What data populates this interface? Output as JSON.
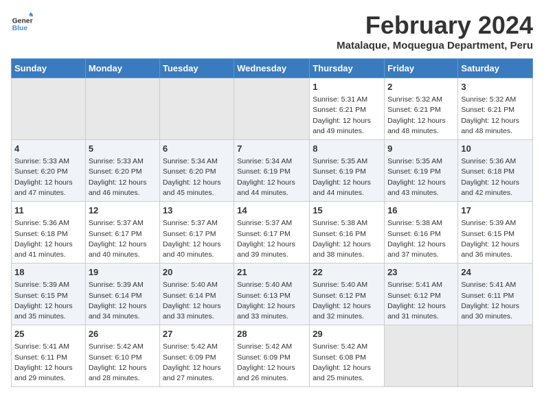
{
  "header": {
    "logo_line1": "General",
    "logo_line2": "Blue",
    "month": "February 2024",
    "location": "Matalaque, Moquegua Department, Peru"
  },
  "weekdays": [
    "Sunday",
    "Monday",
    "Tuesday",
    "Wednesday",
    "Thursday",
    "Friday",
    "Saturday"
  ],
  "weeks": [
    [
      {
        "day": "",
        "text": ""
      },
      {
        "day": "",
        "text": ""
      },
      {
        "day": "",
        "text": ""
      },
      {
        "day": "",
        "text": ""
      },
      {
        "day": "1",
        "text": "Sunrise: 5:31 AM\nSunset: 6:21 PM\nDaylight: 12 hours and 49 minutes."
      },
      {
        "day": "2",
        "text": "Sunrise: 5:32 AM\nSunset: 6:21 PM\nDaylight: 12 hours and 48 minutes."
      },
      {
        "day": "3",
        "text": "Sunrise: 5:32 AM\nSunset: 6:21 PM\nDaylight: 12 hours and 48 minutes."
      }
    ],
    [
      {
        "day": "4",
        "text": "Sunrise: 5:33 AM\nSunset: 6:20 PM\nDaylight: 12 hours and 47 minutes."
      },
      {
        "day": "5",
        "text": "Sunrise: 5:33 AM\nSunset: 6:20 PM\nDaylight: 12 hours and 46 minutes."
      },
      {
        "day": "6",
        "text": "Sunrise: 5:34 AM\nSunset: 6:20 PM\nDaylight: 12 hours and 45 minutes."
      },
      {
        "day": "7",
        "text": "Sunrise: 5:34 AM\nSunset: 6:19 PM\nDaylight: 12 hours and 44 minutes."
      },
      {
        "day": "8",
        "text": "Sunrise: 5:35 AM\nSunset: 6:19 PM\nDaylight: 12 hours and 44 minutes."
      },
      {
        "day": "9",
        "text": "Sunrise: 5:35 AM\nSunset: 6:19 PM\nDaylight: 12 hours and 43 minutes."
      },
      {
        "day": "10",
        "text": "Sunrise: 5:36 AM\nSunset: 6:18 PM\nDaylight: 12 hours and 42 minutes."
      }
    ],
    [
      {
        "day": "11",
        "text": "Sunrise: 5:36 AM\nSunset: 6:18 PM\nDaylight: 12 hours and 41 minutes."
      },
      {
        "day": "12",
        "text": "Sunrise: 5:37 AM\nSunset: 6:17 PM\nDaylight: 12 hours and 40 minutes."
      },
      {
        "day": "13",
        "text": "Sunrise: 5:37 AM\nSunset: 6:17 PM\nDaylight: 12 hours and 40 minutes."
      },
      {
        "day": "14",
        "text": "Sunrise: 5:37 AM\nSunset: 6:17 PM\nDaylight: 12 hours and 39 minutes."
      },
      {
        "day": "15",
        "text": "Sunrise: 5:38 AM\nSunset: 6:16 PM\nDaylight: 12 hours and 38 minutes."
      },
      {
        "day": "16",
        "text": "Sunrise: 5:38 AM\nSunset: 6:16 PM\nDaylight: 12 hours and 37 minutes."
      },
      {
        "day": "17",
        "text": "Sunrise: 5:39 AM\nSunset: 6:15 PM\nDaylight: 12 hours and 36 minutes."
      }
    ],
    [
      {
        "day": "18",
        "text": "Sunrise: 5:39 AM\nSunset: 6:15 PM\nDaylight: 12 hours and 35 minutes."
      },
      {
        "day": "19",
        "text": "Sunrise: 5:39 AM\nSunset: 6:14 PM\nDaylight: 12 hours and 34 minutes."
      },
      {
        "day": "20",
        "text": "Sunrise: 5:40 AM\nSunset: 6:14 PM\nDaylight: 12 hours and 33 minutes."
      },
      {
        "day": "21",
        "text": "Sunrise: 5:40 AM\nSunset: 6:13 PM\nDaylight: 12 hours and 33 minutes."
      },
      {
        "day": "22",
        "text": "Sunrise: 5:40 AM\nSunset: 6:12 PM\nDaylight: 12 hours and 32 minutes."
      },
      {
        "day": "23",
        "text": "Sunrise: 5:41 AM\nSunset: 6:12 PM\nDaylight: 12 hours and 31 minutes."
      },
      {
        "day": "24",
        "text": "Sunrise: 5:41 AM\nSunset: 6:11 PM\nDaylight: 12 hours and 30 minutes."
      }
    ],
    [
      {
        "day": "25",
        "text": "Sunrise: 5:41 AM\nSunset: 6:11 PM\nDaylight: 12 hours and 29 minutes."
      },
      {
        "day": "26",
        "text": "Sunrise: 5:42 AM\nSunset: 6:10 PM\nDaylight: 12 hours and 28 minutes."
      },
      {
        "day": "27",
        "text": "Sunrise: 5:42 AM\nSunset: 6:09 PM\nDaylight: 12 hours and 27 minutes."
      },
      {
        "day": "28",
        "text": "Sunrise: 5:42 AM\nSunset: 6:09 PM\nDaylight: 12 hours and 26 minutes."
      },
      {
        "day": "29",
        "text": "Sunrise: 5:42 AM\nSunset: 6:08 PM\nDaylight: 12 hours and 25 minutes."
      },
      {
        "day": "",
        "text": ""
      },
      {
        "day": "",
        "text": ""
      }
    ]
  ]
}
